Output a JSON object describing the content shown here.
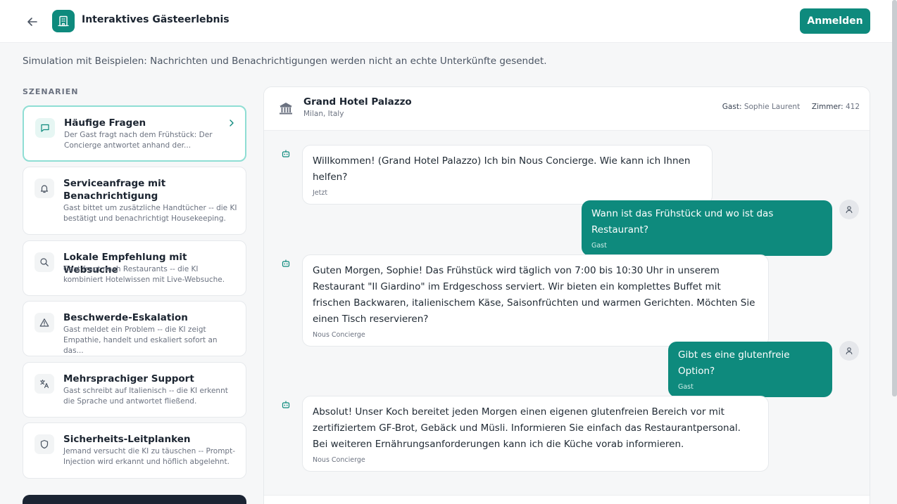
{
  "header": {
    "back_icon": "arrow-left-icon",
    "logo_icon": "building-icon",
    "title": "Interaktives Gästeerlebnis",
    "login_label": "Anmelden",
    "accent_color": "#0e8a7d"
  },
  "notice": "Simulation mit Beispielen: Nachrichten und Benachrichtigungen werden nicht an echte Unterkünfte gesendet.",
  "scenarios": {
    "heading": "SZENARIEN",
    "items": [
      {
        "icon": "chat-bubble-icon",
        "title": "Häufige Fragen",
        "description": "Der Gast fragt nach dem Frühstück: Der Concierge antwortet anhand der...",
        "active": true
      },
      {
        "icon": "bell-icon",
        "title": "Serviceanfrage mit Benachrichtigung",
        "description": "Gast bittet um zusätzliche Handtücher -- die KI bestätigt und benachrichtigt Housekeeping."
      },
      {
        "icon": "search-icon",
        "title": "Lokale Empfehlung mit Websuche",
        "description": "Gast fragt nach Restaurants -- die KI kombiniert Hotelwissen mit Live-Websuche."
      },
      {
        "icon": "warning-triangle-icon",
        "title": "Beschwerde-Eskalation",
        "description": "Gast meldet ein Problem -- die KI zeigt Empathie, handelt und eskaliert sofort an das..."
      },
      {
        "icon": "translate-icon",
        "title": "Mehrsprachiger Support",
        "description": "Gast schreibt auf Italienisch -- die KI erkennt die Sprache und antwortet fließend."
      },
      {
        "icon": "shield-icon",
        "title": "Sicherheits-Leitplanken",
        "description": "Jemand versucht die KI zu täuschen -- Prompt-Injection wird erkannt und höflich abgelehnt."
      }
    ]
  },
  "chat": {
    "hotel_name": "Grand Hotel Palazzo",
    "hotel_location": "Milan, Italy",
    "guest_label": "Gast:",
    "guest_name": "Sophie Laurent",
    "room_label": "Zimmer:",
    "room_number": "412",
    "messages": [
      {
        "role": "bot",
        "text": "Willkommen! (Grand Hotel Palazzo) Ich bin Nous Concierge. Wie kann ich Ihnen helfen?",
        "meta": "Jetzt"
      },
      {
        "role": "user",
        "text": "Wann ist das Frühstück und wo ist das Restaurant?",
        "meta": "Gast"
      },
      {
        "role": "bot",
        "text": "Guten Morgen, Sophie! Das Frühstück wird täglich von 7:00 bis 10:30 Uhr in unserem Restaurant \"Il Giardino\" im Erdgeschoss serviert. Wir bieten ein komplettes Buffet mit frischen Backwaren, italienischem Käse, Saisonfrüchten und warmen Gerichten. Möchten Sie einen Tisch reservieren?",
        "meta": "Nous Concierge"
      },
      {
        "role": "user",
        "text": "Gibt es eine glutenfreie Option?",
        "meta": "Gast"
      },
      {
        "role": "bot",
        "text": "Absolut! Unser Koch bereitet jeden Morgen einen eigenen glutenfreien Bereich vor mit zertifiziertem GF-Brot, Gebäck und Müsli. Informieren Sie einfach das Restaurantpersonal. Bei weiteren Ernährungsanforderungen kann ich die Küche vorab informieren.",
        "meta": "Nous Concierge"
      }
    ]
  }
}
